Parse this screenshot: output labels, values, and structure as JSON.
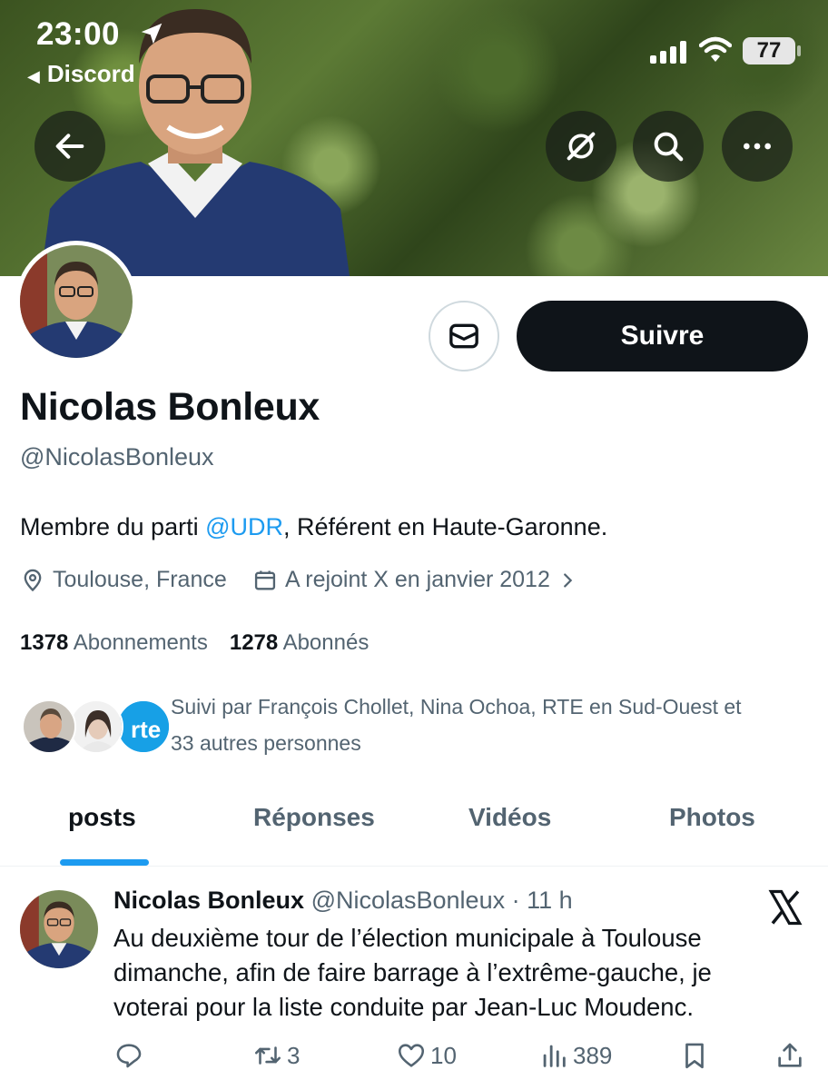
{
  "status_bar": {
    "time": "23:00",
    "back_app": "Discord",
    "battery": "77"
  },
  "profile": {
    "name": "Nicolas Bonleux",
    "handle": "@NicolasBonleux",
    "bio_prefix": "Membre du parti ",
    "bio_mention": "@UDR",
    "bio_suffix": ", Référent en Haute-Garonne.",
    "location": "Toulouse, France",
    "joined": "A rejoint X en janvier 2012",
    "following_count": "1378",
    "following_label": "Abonnements",
    "followers_count": "1278",
    "followers_label": "Abonnés",
    "followed_by_line1": "Suivi par François Chollet, Nina Ochoa, RTE en Sud-Ouest et",
    "followed_by_line2": "33 autres personnes",
    "follow_button": "Suivre"
  },
  "tabs": [
    {
      "label": "posts",
      "active": true
    },
    {
      "label": "Réponses",
      "active": false
    },
    {
      "label": "Vidéos",
      "active": false
    },
    {
      "label": "Photos",
      "active": false
    }
  ],
  "post": {
    "author": "Nicolas Bonleux",
    "handle_time": "@NicolasBonleux · 11 h",
    "line1": "Au deuxième tour de l’élection municipale à Toulouse",
    "line2": "dimanche, afin de faire barrage à l’extrême-gauche, je",
    "line3": "voterai pour la liste conduite par Jean-Luc Moudenc.",
    "reposts": "3",
    "likes": "10",
    "views": "389"
  },
  "colors": {
    "accent": "#1d9bf0",
    "text": "#0f1419",
    "secondary": "#536471"
  }
}
